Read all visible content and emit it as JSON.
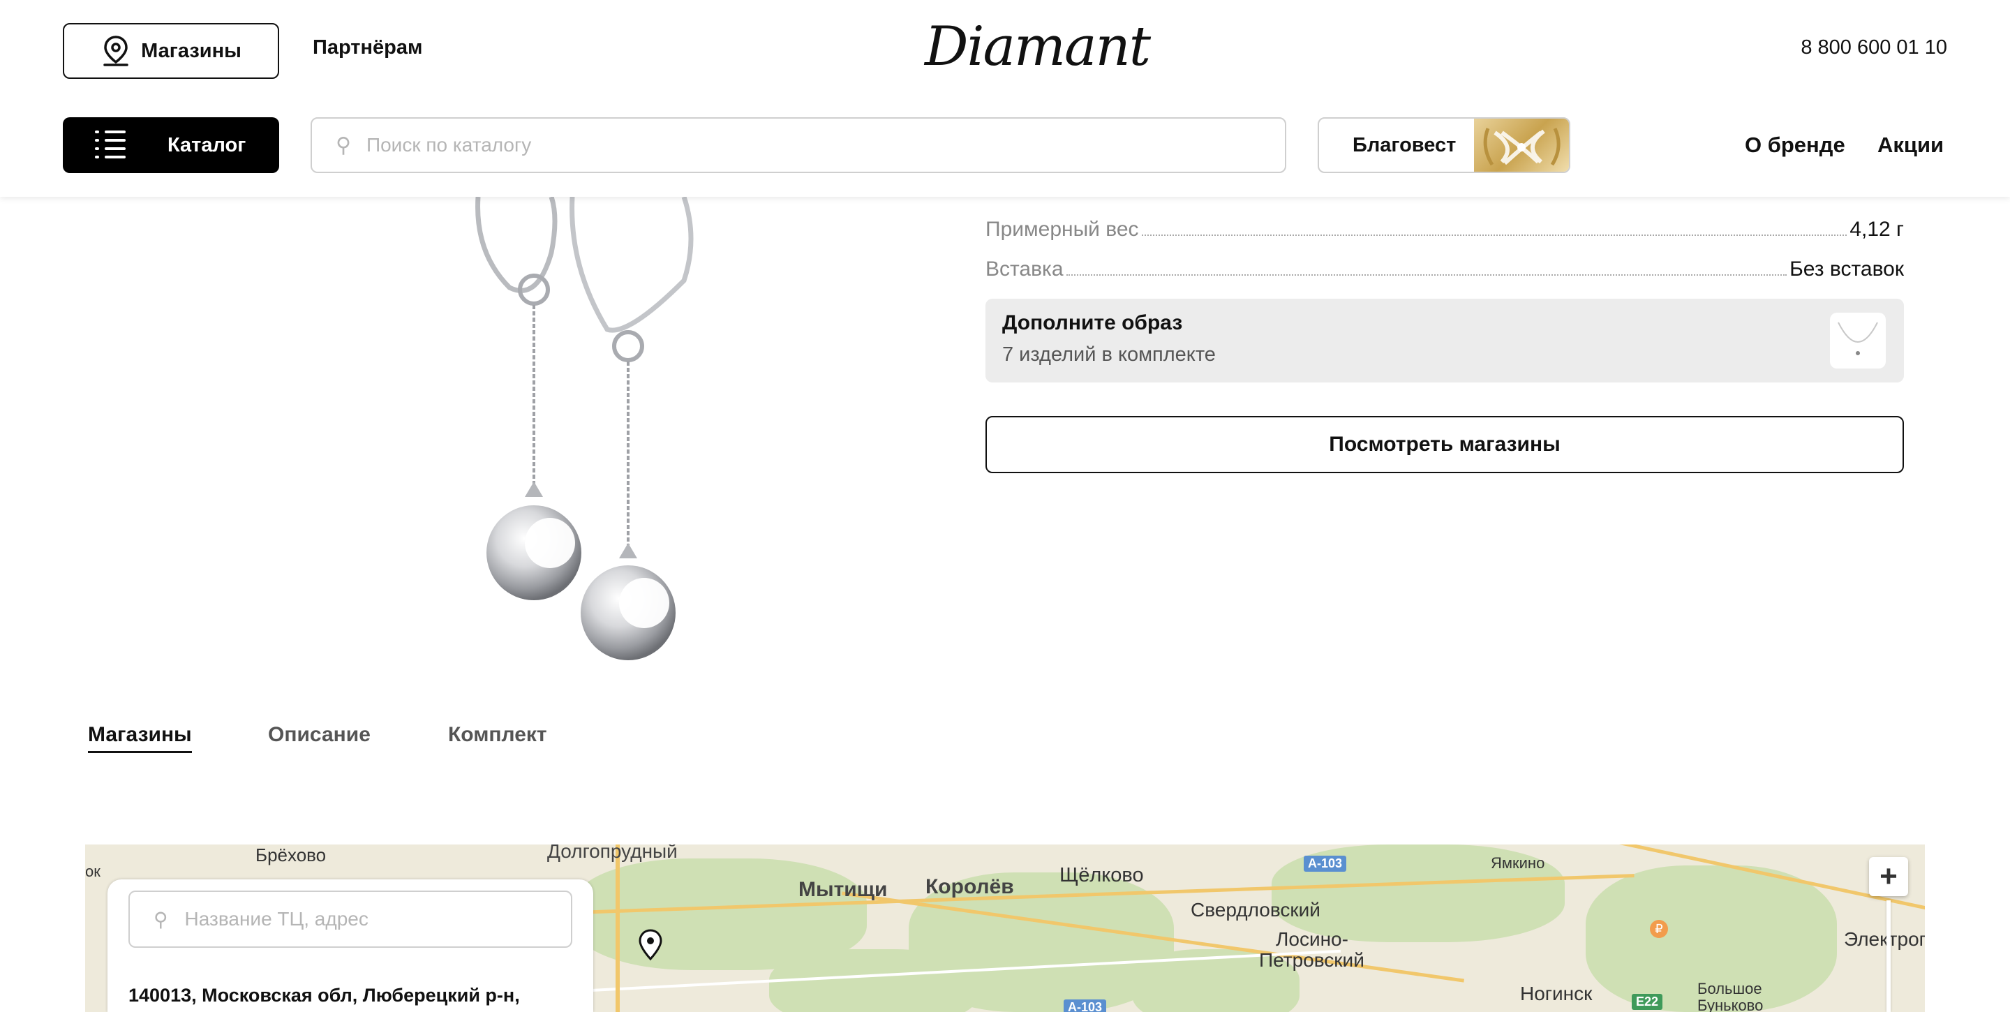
{
  "header": {
    "stores_label": "Магазины",
    "partners_label": "Партнёрам",
    "logo_text": "Diamant",
    "phone": "8 800 600 01 10",
    "catalog_label": "Каталог",
    "search_placeholder": "Поиск по каталогу",
    "promo_label": "Благовест",
    "nav": {
      "brand": "О бренде",
      "sales": "Акции"
    }
  },
  "product": {
    "specs": [
      {
        "key": "Примерный вес",
        "value": "4,12 г"
      },
      {
        "key": "Вставка",
        "value": "Без вставок"
      }
    ],
    "addon": {
      "title": "Дополните образ",
      "subtitle": "7 изделий в комплекте"
    },
    "view_stores_label": "Посмотреть магазины"
  },
  "tabs": [
    {
      "label": "Магазины",
      "active": true
    },
    {
      "label": "Описание",
      "active": false
    },
    {
      "label": "Комплект",
      "active": false
    }
  ],
  "map": {
    "search_placeholder": "Название ТЦ, адрес",
    "address": "140013, Московская обл, Люберецкий р-н,",
    "cities": {
      "c1": "Брёхово",
      "c2": "Долгопрудный",
      "c3": "Мытищи",
      "c4": "Королёв",
      "c5": "Щёлково",
      "c6": "Свердловский",
      "c7": "Лосино-",
      "c8": "Петровский",
      "c9": "Ямкино",
      "c10": "Электрог",
      "c11": "Ногинск",
      "c12": "Большое",
      "c13": "Буньково",
      "c14": "ок"
    },
    "road_badges": {
      "r1": "A-103",
      "r2": "A-103",
      "r3": "E22"
    },
    "zoom_in": "+"
  },
  "colors": {
    "accent": "#000000",
    "map_bg": "#eeeadb",
    "map_green": "#cfe0b4",
    "road": "#f1c76b"
  }
}
